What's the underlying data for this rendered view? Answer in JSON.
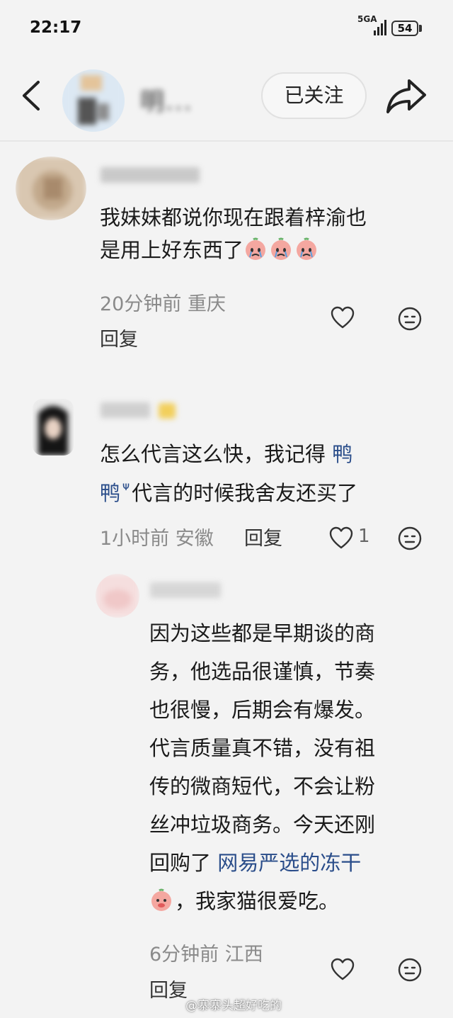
{
  "status_bar": {
    "time": "22:17",
    "network": "5GA",
    "battery": "54"
  },
  "header": {
    "user_name": "明...",
    "follow_label": "已关注"
  },
  "comments": [
    {
      "user_name": "",
      "text_line1": "我妹妹都说你现在跟着梓渝也",
      "text_line2": "是用上好东西了",
      "time": "20分钟前",
      "location": "重庆",
      "reply_label": "回复"
    },
    {
      "user_name": "",
      "text_line1_a": "怎么代言这么快，我记得 ",
      "text_line1_link": "鸭",
      "text_line2_link": "鸭",
      "text_line2_b": "代言的时候我舍友还买了",
      "time": "1小时前",
      "location": "安徽",
      "reply_label": "回复",
      "likes": "1"
    }
  ],
  "reply": {
    "user_name": "",
    "line1": "因为这些都是早期谈的商",
    "line2": "务，他选品很谨慎，节奏",
    "line3": "也很慢，后期会有爆发。",
    "line4": "代言质量真不错，没有祖",
    "line5": "传的微商短代，不会让粉",
    "line6": "丝冲垃圾商务。今天还刚",
    "line7_a": "回购了 ",
    "line7_link": "网易严选的冻干",
    "line8": "，我家猫很爱吃。",
    "time": "6分钟前",
    "location": "江西",
    "reply_label": "回复"
  },
  "watermark": "@寨寨头超好吃的",
  "colors": {
    "background": "#f3f3f3",
    "link": "#2a4d8a",
    "meta": "#8a8a8a"
  },
  "icons": [
    "back-icon",
    "share-icon",
    "heart-icon",
    "emoji-icon",
    "crying-emoji-icon",
    "search-icon",
    "cat-emoji-icon"
  ]
}
